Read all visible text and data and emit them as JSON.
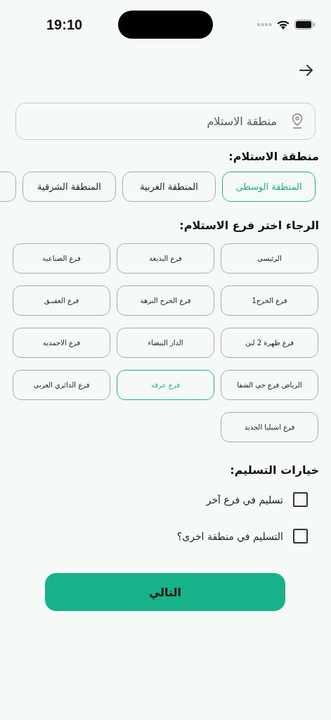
{
  "status_bar": {
    "time": "19:10"
  },
  "location_field": {
    "placeholder": "منطقة الاستلام"
  },
  "region_heading": "منطقة الاستلام:",
  "regions": [
    {
      "label": "المنطقة الوسطى",
      "selected": true
    },
    {
      "label": "المنطقة الغربية",
      "selected": false
    },
    {
      "label": "المنطقة الشرقية",
      "selected": false
    }
  ],
  "branch_heading": "الرجاء اختر فرع الاستلام:",
  "branches": [
    {
      "label": "الرئيسي",
      "selected": false
    },
    {
      "label": "فرع البديعة",
      "selected": false
    },
    {
      "label": "فرع الصناعية",
      "selected": false
    },
    {
      "label": "فرع الخرج1",
      "selected": false
    },
    {
      "label": "فرع الخرج النزهة",
      "selected": false
    },
    {
      "label": "فرع العقيـق",
      "selected": false
    },
    {
      "label": "فرع ظهرة 2 لبن",
      "selected": false
    },
    {
      "label": "الدار البيضاء",
      "selected": false
    },
    {
      "label": "فرع الاحمديه",
      "selected": false
    },
    {
      "label": "الرياض فرع حي الشفا",
      "selected": false
    },
    {
      "label": "فرع عرقه",
      "selected": true
    },
    {
      "label": "فرع الدائري الغربي",
      "selected": false
    },
    {
      "label": "فرع اشبليا الجديد",
      "selected": false
    }
  ],
  "delivery_heading": "خيارات التسليم:",
  "delivery_options": [
    {
      "label": "تسليم في فرع آخر",
      "checked": false
    },
    {
      "label": "التسليم في منطقة اخرى؟",
      "checked": false
    }
  ],
  "next_button": "التالي"
}
